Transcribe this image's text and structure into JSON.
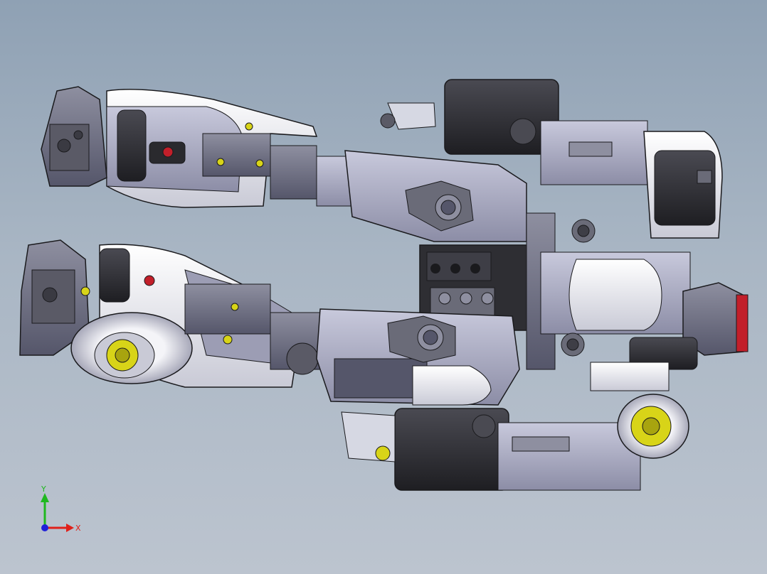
{
  "viewport": {
    "background_top": "#8fa1b4",
    "background_bottom": "#bcc4cf"
  },
  "model": {
    "name": "",
    "colors": {
      "dark_part": "#2e2e33",
      "mid_part": "#6a6b78",
      "light_part": "#d6d8e3",
      "white_part": "#f2f2f6",
      "lavender": "#9c9db4",
      "accent_yellow": "#d8d418",
      "accent_red": "#c21f2a",
      "edge": "#1a1a1d"
    }
  },
  "triad": {
    "x_label": "X",
    "y_label": "Y",
    "x_color": "#e0201a",
    "y_color": "#1fb81f",
    "z_color": "#2020d8"
  }
}
